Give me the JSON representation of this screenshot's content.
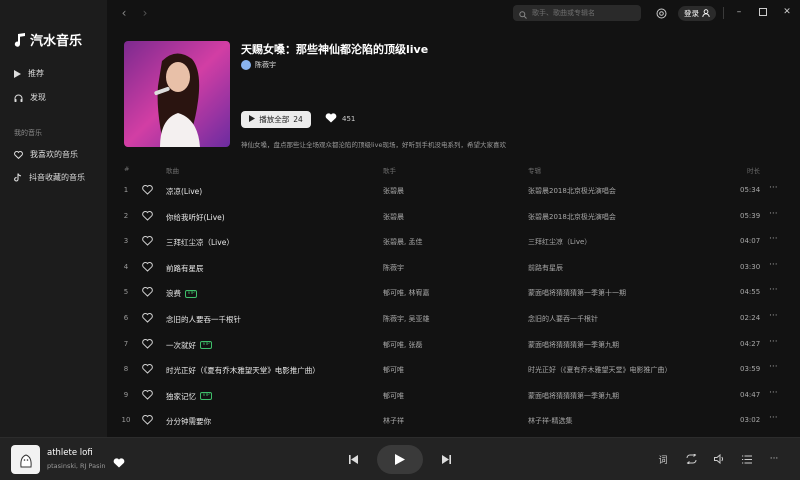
{
  "app": {
    "logo_text": "汽水音乐"
  },
  "sidebar": {
    "items": [
      {
        "label": "推荐",
        "icon": "play-triangle-icon"
      },
      {
        "label": "发现",
        "icon": "headphones-icon"
      }
    ],
    "section_label": "我的音乐",
    "my_items": [
      {
        "label": "我喜欢的音乐",
        "icon": "heart-outline-icon"
      },
      {
        "label": "抖音收藏的音乐",
        "icon": "douyin-icon"
      }
    ]
  },
  "topbar": {
    "search_placeholder": "歌手、歌曲或专辑名",
    "login_label": "登录"
  },
  "playlist": {
    "title": "天赐女嗓：那些神仙都沦陷的顶级live",
    "creator": "陈薇宇",
    "play_all_label": "播放全部",
    "track_count": "24",
    "likes": "451",
    "description": "神仙女嗓，盘点那些让全场观众都沦陷的顶级live现场，好听到手机没电系列，希望大家喜欢"
  },
  "table": {
    "headers": {
      "num": "#",
      "title": "歌曲",
      "artist": "歌手",
      "album": "专辑",
      "duration": "时长"
    },
    "rows": [
      {
        "num": "1",
        "title": "凉凉(Live)",
        "vip": false,
        "artist": "张碧晨",
        "album": "张碧晨2018北京极光演唱会",
        "duration": "05:34"
      },
      {
        "num": "2",
        "title": "你给我听好(Live)",
        "vip": false,
        "artist": "张碧晨",
        "album": "张碧晨2018北京极光演唱会",
        "duration": "05:39"
      },
      {
        "num": "3",
        "title": "三拜红尘凉（Live）",
        "vip": false,
        "artist": "张碧晨, 孟佳",
        "album": "三拜红尘凉（Live）",
        "duration": "04:07"
      },
      {
        "num": "4",
        "title": "前路有星辰",
        "vip": false,
        "artist": "陈薇宇",
        "album": "前路有星辰",
        "duration": "03:30"
      },
      {
        "num": "5",
        "title": "浪费",
        "vip": true,
        "artist": "郁可唯, 林宥嘉",
        "album": "蒙面唱将猜猜猜第一季第十一期",
        "duration": "04:55"
      },
      {
        "num": "6",
        "title": "念旧的人要吞一千根针",
        "vip": false,
        "artist": "陈薇宇, 吴亚雄",
        "album": "念旧的人要吞一千根针",
        "duration": "02:24"
      },
      {
        "num": "7",
        "title": "一次就好",
        "vip": true,
        "artist": "郁可唯, 张磊",
        "album": "蒙面唱将猜猜猜第一季第九期",
        "duration": "04:27"
      },
      {
        "num": "8",
        "title": "时光正好（《夏有乔木雅望天堂》电影推广曲）",
        "vip": false,
        "artist": "郁可唯",
        "album": "时光正好（《夏有乔木雅望天堂》电影推广曲）",
        "duration": "03:59"
      },
      {
        "num": "9",
        "title": "独家记忆",
        "vip": true,
        "artist": "郁可唯",
        "album": "蒙面唱将猜猜猜第一季第九期",
        "duration": "04:47"
      },
      {
        "num": "10",
        "title": "分分钟需要你",
        "vip": false,
        "artist": "林子祥",
        "album": "林子祥-精选集",
        "duration": "03:02"
      }
    ],
    "vip_label": "VIP",
    "more_label": "···"
  },
  "player": {
    "title": "athlete lofi",
    "artist": "ptasinski, RJ Pasin",
    "lyrics_label": "词",
    "more_label": "···"
  },
  "colors": {
    "background": "#121212",
    "sidebar": "#1c1c1c",
    "player_bar": "#232323",
    "vip_green": "#3fbf6a"
  }
}
